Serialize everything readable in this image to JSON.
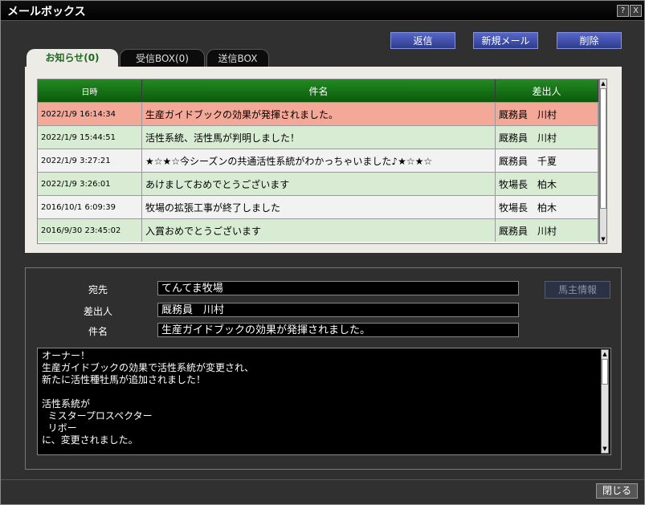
{
  "window": {
    "title": "メールボックス",
    "help_label": "?",
    "close_label": "X"
  },
  "actions": {
    "reply": "返信",
    "new_mail": "新規メール",
    "delete": "削除"
  },
  "tabs": [
    {
      "label": "お知らせ(0)",
      "active": true
    },
    {
      "label": "受信BOX(0)",
      "active": false
    },
    {
      "label": "送信BOX",
      "active": false
    }
  ],
  "table": {
    "headers": {
      "date": "日時",
      "subject": "件名",
      "sender": "差出人"
    },
    "rows": [
      {
        "date": "2022/1/9 16:14:34",
        "subject": "生産ガイドブックの効果が発揮されました。",
        "sender": "厩務員　川村",
        "state": "selected"
      },
      {
        "date": "2022/1/9 15:44:51",
        "subject": "活性系統、活性馬が判明しました！",
        "sender": "厩務員　川村",
        "state": "green"
      },
      {
        "date": "2022/1/9 3:27:21",
        "subject": "★☆★☆今シーズンの共通活性系統がわかっちゃいました♪★☆★☆",
        "sender": "厩務員　千夏",
        "state": "white"
      },
      {
        "date": "2022/1/9 3:26:01",
        "subject": "あけましておめでとうございます",
        "sender": "牧場長　柏木",
        "state": "green"
      },
      {
        "date": "2016/10/1 6:09:39",
        "subject": "牧場の拡張工事が終了しました",
        "sender": "牧場長　柏木",
        "state": "white"
      },
      {
        "date": "2016/9/30 23:45:02",
        "subject": "入賞おめでとうございます",
        "sender": "厩務員　川村",
        "state": "green"
      }
    ]
  },
  "detail": {
    "to_label": "宛先",
    "to_value": "てんてま牧場",
    "from_label": "差出人",
    "from_value": "厩務員　川村",
    "subject_label": "件名",
    "subject_value": "生産ガイドブックの効果が発揮されました。",
    "owner_info_button": "馬主情報",
    "body": "オーナー！\n生産ガイドブックの効果で活性系統が変更され、\n新たに活性種牡馬が追加されました！\n\n活性系統が\n  ミスタープロスペクター\n  リボー\nに、変更されました。"
  },
  "footer": {
    "close_label": "閉じる"
  },
  "colors": {
    "selected_row": "#f4a898",
    "green_row": "#d8ecd3",
    "header_green": "#1a7a1a",
    "button_blue": "#3f4fb0"
  }
}
